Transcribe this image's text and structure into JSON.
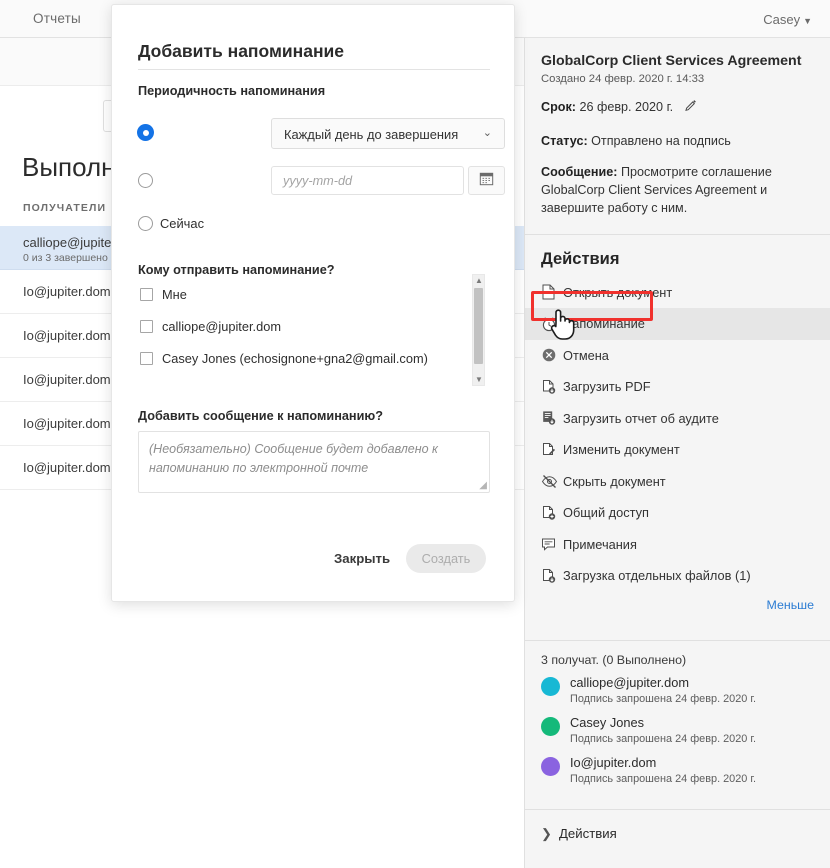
{
  "topbar": {
    "tab_label": "Отчеты",
    "user_label": "Casey",
    "caret": "▼"
  },
  "leftpane": {
    "title": "Выполня",
    "column_header": "ПОЛУЧАТЕЛИ",
    "rows": [
      {
        "main": "calliope@jupiter",
        "sub": "0 из 3 завершено",
        "selected": true
      },
      {
        "main": "Io@jupiter.dom",
        "sub": "",
        "selected": false
      },
      {
        "main": "Io@jupiter.dom",
        "sub": "",
        "selected": false
      },
      {
        "main": "Io@jupiter.dom",
        "sub": "",
        "selected": false
      },
      {
        "main": "Io@jupiter.dom",
        "sub": "",
        "selected": false
      },
      {
        "main": "Io@jupiter.dom",
        "sub": "",
        "selected": false
      }
    ]
  },
  "modal": {
    "title": "Добавить напоминание",
    "frequency_label": "Периодичность напоминания",
    "frequency_select_value": "Каждый день до завершения",
    "frequency_select_caret": "⌄",
    "date_placeholder": "yyyy-mm-dd",
    "now_label": "Сейчас",
    "recipients_question": "Кому отправить напоминание?",
    "recipients": [
      {
        "label": "Мне",
        "checked": false
      },
      {
        "label": "calliope@jupiter.dom",
        "checked": false
      },
      {
        "label": "Casey Jones (echosignone+gna2@gmail.com)",
        "checked": false
      }
    ],
    "message_question": "Добавить сообщение к напоминанию?",
    "message_placeholder": "(Необязательно) Сообщение будет добавлено к напоминанию по электронной почте",
    "close_label": "Закрыть",
    "create_label": "Создать",
    "scroll_up": "▲",
    "scroll_down": "▼"
  },
  "sidebar": {
    "doc_title": "GlobalCorp Client Services Agreement",
    "created": "Создано 24 февр. 2020 г. 14:33",
    "due_label": "Срок:",
    "due_value": "26 февр. 2020 г.",
    "status_label": "Статус:",
    "status_value": "Отправлено на подпись",
    "message_label": "Сообщение:",
    "message_value": "Просмотрите соглашение GlobalCorp Client Services Agreement и завершите работу с ним.",
    "actions_heading": "Действия",
    "actions": [
      {
        "label": "Открыть документ",
        "icon": "document-icon",
        "highlighted": false
      },
      {
        "label": "Напоминание",
        "icon": "alarm-clock-icon",
        "highlighted": true
      },
      {
        "label": "Отмена",
        "icon": "cancel-icon",
        "highlighted": false
      },
      {
        "label": "Загрузить PDF",
        "icon": "download-pdf-icon",
        "highlighted": false
      },
      {
        "label": "Загрузить отчет об аудите",
        "icon": "download-audit-icon",
        "highlighted": false
      },
      {
        "label": "Изменить документ",
        "icon": "edit-document-icon",
        "highlighted": false
      },
      {
        "label": "Скрыть документ",
        "icon": "hide-eye-icon",
        "highlighted": false
      },
      {
        "label": "Общий доступ",
        "icon": "share-icon",
        "highlighted": false
      },
      {
        "label": "Примечания",
        "icon": "notes-icon",
        "highlighted": false
      },
      {
        "label": "Загрузка отдельных файлов (1)",
        "icon": "download-files-icon",
        "highlighted": false
      }
    ],
    "less_link": "Меньше",
    "recipients_summary": "3 получат. (0 Выполнено)",
    "recipients": [
      {
        "name": "calliope@jupiter.dom",
        "status": "Подпись запрошена 24 февр. 2020 г.",
        "color": "#17b8d4"
      },
      {
        "name": "Casey Jones",
        "status": "Подпись запрошена 24 февр. 2020 г.",
        "color": "#14b97a"
      },
      {
        "name": "Io@jupiter.dom",
        "status": "Подпись запрошена 24 февр. 2020 г.",
        "color": "#8a63e0"
      }
    ],
    "collapse_label": "Действия",
    "collapse_chevron": "❯"
  },
  "colors": {
    "accent": "#1473e6",
    "link": "#2b7cd3",
    "highlight_box": "#f0312d",
    "row_selected": "#dce8f7"
  }
}
